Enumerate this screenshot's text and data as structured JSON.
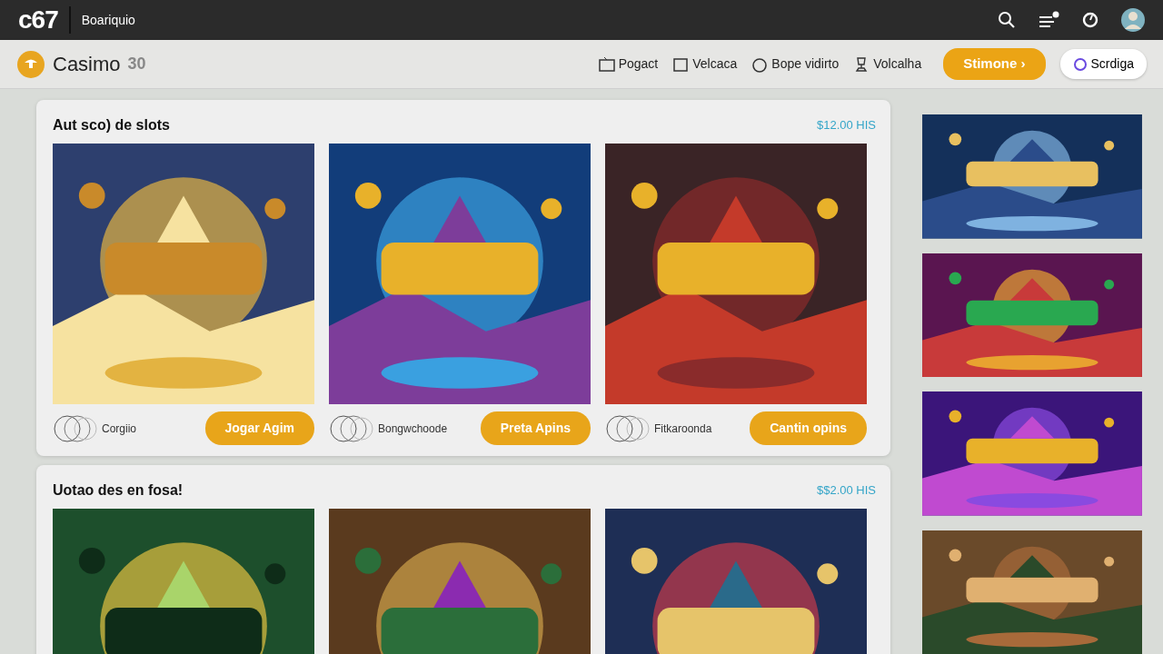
{
  "topbar": {
    "logo": "c67",
    "subtitle": "Boariquio"
  },
  "subnav": {
    "brand": "Casimo",
    "brand_suffix": "30",
    "links": [
      {
        "label": "Pogact"
      },
      {
        "label": "Velcaca"
      },
      {
        "label": "Bope vidirto"
      },
      {
        "label": "Volcalha"
      }
    ],
    "primary_button": "Stimone ›",
    "secondary_button": "Scrdiga"
  },
  "sections": [
    {
      "title": "Aut sco) de slots",
      "amount": "$12.00 HIS",
      "games": [
        {
          "kind": "picture",
          "provider": "Corgiio",
          "button": "Jogar Agim"
        },
        {
          "kind": "picture",
          "provider": "Bongwchoode",
          "button": "Preta Apins"
        },
        {
          "kind": "picture",
          "provider": "Fitkaroonda",
          "button": "Cantin opins"
        }
      ]
    },
    {
      "title": "Uotao des en fosa!",
      "amount": "$$2.00 HIS"
    }
  ]
}
